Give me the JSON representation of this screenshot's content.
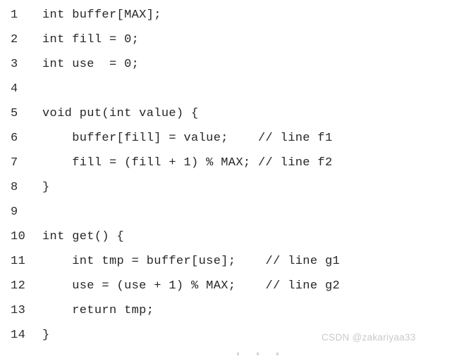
{
  "editor": {
    "language": "c",
    "background_color": "#ffffff",
    "text_color": "#262626",
    "line_number_color": "#2b2b2b",
    "lines": [
      {
        "number": "1",
        "code": "int buffer[MAX];"
      },
      {
        "number": "2",
        "code": "int fill = 0;"
      },
      {
        "number": "3",
        "code": "int use  = 0;"
      },
      {
        "number": "4",
        "code": ""
      },
      {
        "number": "5",
        "code": "void put(int value) {"
      },
      {
        "number": "6",
        "code": "    buffer[fill] = value;    // line f1"
      },
      {
        "number": "7",
        "code": "    fill = (fill + 1) % MAX; // line f2"
      },
      {
        "number": "8",
        "code": "}"
      },
      {
        "number": "9",
        "code": ""
      },
      {
        "number": "10",
        "code": "int get() {"
      },
      {
        "number": "11",
        "code": "    int tmp = buffer[use];    // line g1"
      },
      {
        "number": "12",
        "code": "    use = (use + 1) % MAX;    // line g2"
      },
      {
        "number": "13",
        "code": "    return tmp;"
      },
      {
        "number": "14",
        "code": "}"
      }
    ]
  },
  "watermark": {
    "text": "CSDN @zakariyaa33",
    "color": "#c9c9c9"
  }
}
